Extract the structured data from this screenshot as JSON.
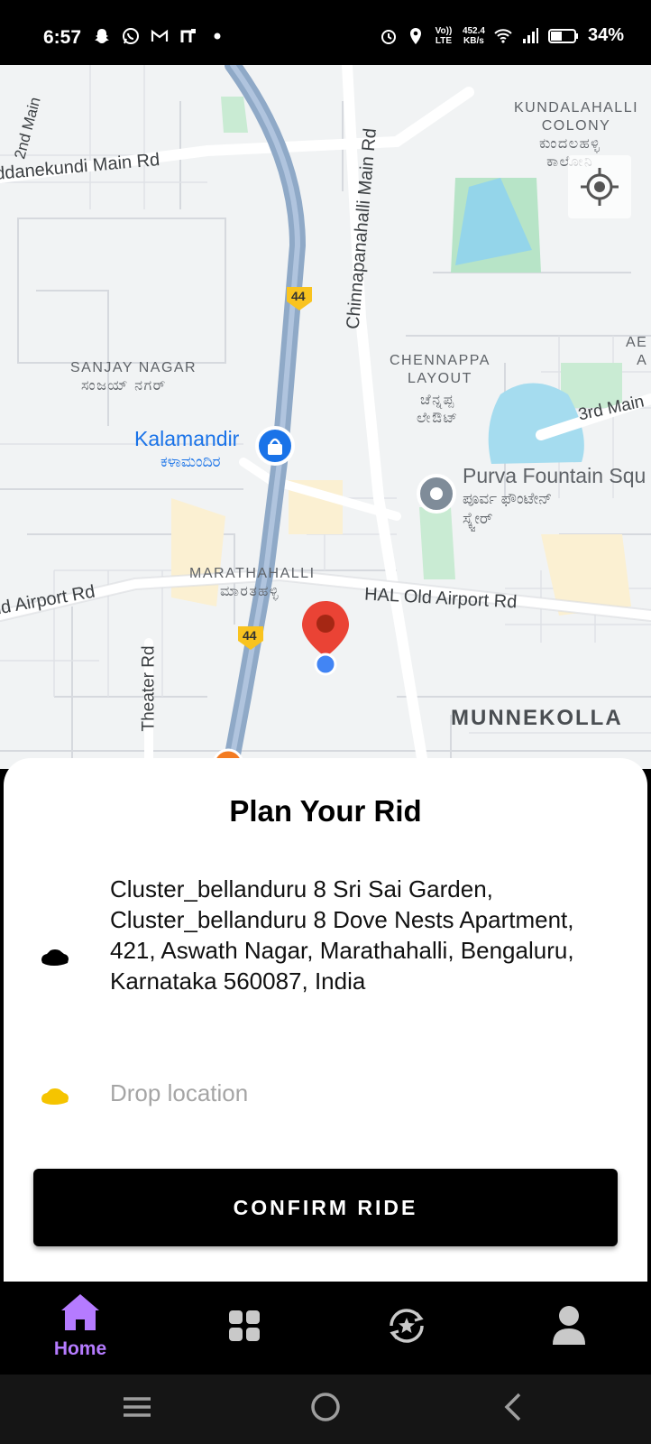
{
  "status_bar": {
    "time": "6:57",
    "net_speed_value": "452.4",
    "net_speed_unit": "KB/s",
    "volte": "Vo)) LTE",
    "battery": "34%"
  },
  "map": {
    "road_labels": {
      "second_main": "2nd Main",
      "doddanekundi": "ddanekundi Main Rd",
      "chinnapanahalli": "Chinnapanahalli Main Rd",
      "third_main": "3rd Main",
      "old_airport_left": "ld Airport Rd",
      "hal_old_airport": "HAL Old Airport Rd",
      "theater": "Theater Rd"
    },
    "highway_shield": "44",
    "areas": {
      "kundalahalli": "KUNDALAHALLI\nCOLONY",
      "kundalahalli_local": "ಕುಂದಲಹಳ್ಳಿ\nಕಾಲೋನಿ",
      "sanjay_nagar": "SANJAY NAGAR",
      "sanjay_nagar_local": "ಸಂಜಯ್ ನಗರ್",
      "chennappa": "CHENNAPPA\nLAYOUT",
      "chennappa_local": "ಚೆನ್ನಪ್ಪ\nಲೇಔಟ್",
      "marathahalli": "MARATHAHALLI",
      "marathahalli_local": "ಮಾರತಹಳ್ಳಿ",
      "munnekolla": "MUNNEKOLLA",
      "edge_ab": "AE\nA"
    },
    "pois": {
      "kalamandir": "Kalamandir",
      "kalamandir_local": "ಕಳಾಮಂದಿರ",
      "purva": "Purva Fountain Squ",
      "purva_local": "ಪೂರ್ವ ಫೌಂಟೇನ್\nಸ್ಕ್ವೇರ್"
    }
  },
  "sheet": {
    "title": "Plan Your Rid",
    "pickup_address": "Cluster_bellanduru 8 Sri Sai Garden, Cluster_bellanduru 8 Dove Nests Apartment, 421, Aswath Nagar, Marathahalli, Bengaluru, Karnataka 560087, India",
    "drop_placeholder": "Drop location",
    "confirm_label": "CONFIRM RIDE"
  },
  "bottom_nav": {
    "home_label": "Home",
    "active_color": "#b57bff",
    "inactive_color": "#c9c9c9"
  },
  "icons": {
    "pickup": "black-car-icon",
    "drop": "yellow-car-icon",
    "marker": "red-location-pin-icon"
  }
}
